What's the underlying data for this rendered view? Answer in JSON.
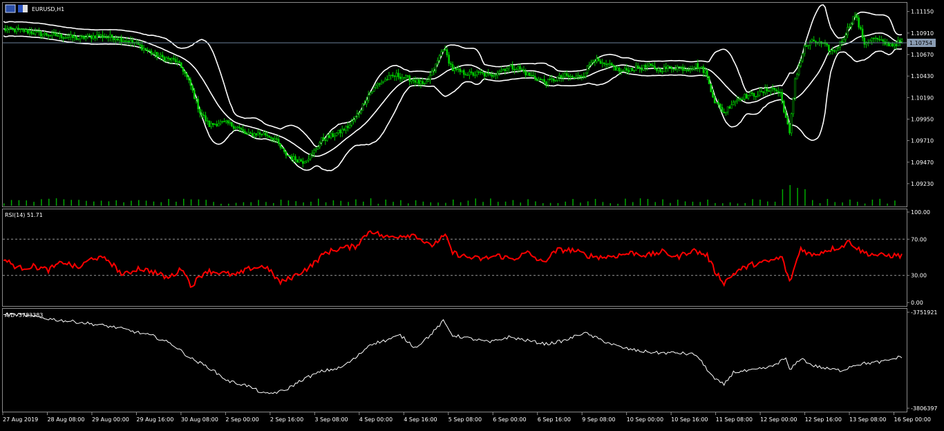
{
  "window": {
    "symbol_label": "EURUSD,H1"
  },
  "chart_data": [
    {
      "type": "candlestick",
      "title": "EURUSD,H1",
      "y_ticks": [
        "1.11150",
        "1.10910",
        "1.10670",
        "1.10430",
        "1.10190",
        "1.09950",
        "1.09710",
        "1.09470",
        "1.09230"
      ],
      "ylim": [
        1.0916,
        1.1124
      ],
      "current_price": "1.10754",
      "colors": {
        "candles": "#00cc00",
        "bands": "#ffffff",
        "price_line": "#6a7f99",
        "volume": "#00aa00"
      },
      "indicators": [
        "Bollinger Bands",
        "Volumes"
      ],
      "close_path": [
        [
          0,
          1.1095
        ],
        [
          10,
          1.1094
        ],
        [
          20,
          1.109
        ],
        [
          30,
          1.1088
        ],
        [
          40,
          1.1085
        ],
        [
          50,
          1.1088
        ],
        [
          60,
          1.1086
        ],
        [
          70,
          1.108
        ],
        [
          78,
          1.107
        ],
        [
          84,
          1.1064
        ],
        [
          88,
          1.1062
        ],
        [
          92,
          1.106
        ],
        [
          96,
          1.105
        ],
        [
          100,
          1.1032
        ],
        [
          105,
          1.1003
        ],
        [
          110,
          1.0988
        ],
        [
          115,
          1.0991
        ],
        [
          120,
          1.099
        ],
        [
          125,
          1.0986
        ],
        [
          130,
          1.0977
        ],
        [
          135,
          1.0979
        ],
        [
          140,
          1.0978
        ],
        [
          145,
          1.0973
        ],
        [
          150,
          1.0957
        ],
        [
          155,
          1.0951
        ],
        [
          160,
          1.0948
        ],
        [
          165,
          1.0956
        ],
        [
          170,
          1.0972
        ],
        [
          175,
          1.0976
        ],
        [
          180,
          1.0981
        ],
        [
          185,
          1.0988
        ],
        [
          190,
          1.1003
        ],
        [
          195,
          1.1022
        ],
        [
          200,
          1.1034
        ],
        [
          205,
          1.104
        ],
        [
          210,
          1.1044
        ],
        [
          215,
          1.1041
        ],
        [
          220,
          1.1038
        ],
        [
          225,
          1.1032
        ],
        [
          230,
          1.105
        ],
        [
          235,
          1.1075
        ],
        [
          240,
          1.105
        ],
        [
          245,
          1.1047
        ],
        [
          250,
          1.1045
        ],
        [
          255,
          1.1046
        ],
        [
          260,
          1.1043
        ],
        [
          265,
          1.1049
        ],
        [
          270,
          1.1053
        ],
        [
          275,
          1.1052
        ],
        [
          280,
          1.1045
        ],
        [
          285,
          1.104
        ],
        [
          290,
          1.1036
        ],
        [
          295,
          1.104
        ],
        [
          300,
          1.1043
        ],
        [
          305,
          1.1041
        ],
        [
          310,
          1.1045
        ],
        [
          315,
          1.1063
        ],
        [
          320,
          1.1055
        ],
        [
          325,
          1.1054
        ],
        [
          330,
          1.1048
        ],
        [
          335,
          1.1051
        ],
        [
          340,
          1.1052
        ],
        [
          345,
          1.1054
        ],
        [
          350,
          1.105
        ],
        [
          355,
          1.1052
        ],
        [
          360,
          1.1053
        ],
        [
          365,
          1.1051
        ],
        [
          370,
          1.1055
        ],
        [
          375,
          1.1048
        ],
        [
          380,
          1.1015
        ],
        [
          385,
          1.1002
        ],
        [
          390,
          1.1015
        ],
        [
          395,
          1.102
        ],
        [
          400,
          1.1022
        ],
        [
          405,
          1.1024
        ],
        [
          410,
          1.103
        ],
        [
          415,
          1.1024
        ],
        [
          420,
          1.0978
        ],
        [
          423,
          1.104
        ],
        [
          428,
          1.1075
        ],
        [
          433,
          1.1082
        ],
        [
          438,
          1.1078
        ],
        [
          443,
          1.107
        ],
        [
          448,
          1.1082
        ],
        [
          452,
          1.11
        ],
        [
          455,
          1.1112
        ],
        [
          460,
          1.108
        ],
        [
          465,
          1.1085
        ],
        [
          470,
          1.108
        ],
        [
          475,
          1.1078
        ],
        [
          480,
          1.1082
        ]
      ]
    },
    {
      "type": "line",
      "title": "RSI(14) 51.71",
      "series": [
        {
          "name": "RSI(14)",
          "color": "#ff0000"
        }
      ],
      "y_ticks": [
        "100.00",
        "70.00",
        "30.00",
        "0.00"
      ],
      "levels": [
        70,
        30
      ],
      "ylim": [
        0,
        100
      ],
      "values_path": [
        [
          0,
          48
        ],
        [
          8,
          38
        ],
        [
          16,
          40
        ],
        [
          24,
          36
        ],
        [
          32,
          45
        ],
        [
          40,
          38
        ],
        [
          48,
          50
        ],
        [
          56,
          47
        ],
        [
          64,
          30
        ],
        [
          72,
          38
        ],
        [
          80,
          34
        ],
        [
          88,
          27
        ],
        [
          96,
          38
        ],
        [
          100,
          18
        ],
        [
          108,
          35
        ],
        [
          116,
          33
        ],
        [
          124,
          30
        ],
        [
          132,
          38
        ],
        [
          140,
          40
        ],
        [
          148,
          22
        ],
        [
          156,
          30
        ],
        [
          164,
          40
        ],
        [
          172,
          55
        ],
        [
          180,
          60
        ],
        [
          188,
          62
        ],
        [
          196,
          80
        ],
        [
          204,
          72
        ],
        [
          212,
          74
        ],
        [
          220,
          75
        ],
        [
          228,
          62
        ],
        [
          236,
          74
        ],
        [
          240,
          55
        ],
        [
          248,
          50
        ],
        [
          256,
          48
        ],
        [
          264,
          52
        ],
        [
          272,
          48
        ],
        [
          280,
          55
        ],
        [
          288,
          44
        ],
        [
          296,
          58
        ],
        [
          304,
          58
        ],
        [
          312,
          52
        ],
        [
          320,
          50
        ],
        [
          328,
          52
        ],
        [
          336,
          55
        ],
        [
          344,
          52
        ],
        [
          352,
          56
        ],
        [
          360,
          50
        ],
        [
          368,
          58
        ],
        [
          376,
          52
        ],
        [
          380,
          35
        ],
        [
          385,
          22
        ],
        [
          392,
          35
        ],
        [
          400,
          42
        ],
        [
          408,
          45
        ],
        [
          416,
          50
        ],
        [
          420,
          22
        ],
        [
          426,
          60
        ],
        [
          432,
          52
        ],
        [
          440,
          58
        ],
        [
          448,
          62
        ],
        [
          452,
          68
        ],
        [
          456,
          60
        ],
        [
          460,
          55
        ],
        [
          468,
          52
        ],
        [
          476,
          52
        ],
        [
          480,
          51.71
        ]
      ]
    },
    {
      "type": "line",
      "title": "A/D -3783383",
      "series": [
        {
          "name": "A/D",
          "color": "#ffffff"
        }
      ],
      "y_ticks": [
        "-3751921",
        "-3806397"
      ],
      "ylim": [
        -3806397,
        -3751921
      ],
      "values_path": [
        [
          0,
          -3753000
        ],
        [
          10,
          -3753500
        ],
        [
          20,
          -3755000
        ],
        [
          30,
          -3756500
        ],
        [
          40,
          -3757500
        ],
        [
          50,
          -3759000
        ],
        [
          60,
          -3760500
        ],
        [
          70,
          -3763000
        ],
        [
          80,
          -3765500
        ],
        [
          90,
          -3770000
        ],
        [
          100,
          -3778000
        ],
        [
          110,
          -3783500
        ],
        [
          120,
          -3791000
        ],
        [
          130,
          -3793500
        ],
        [
          140,
          -3798500
        ],
        [
          150,
          -3796500
        ],
        [
          160,
          -3790000
        ],
        [
          170,
          -3785500
        ],
        [
          180,
          -3783500
        ],
        [
          188,
          -3778000
        ],
        [
          196,
          -3770000
        ],
        [
          204,
          -3768000
        ],
        [
          212,
          -3765000
        ],
        [
          220,
          -3772000
        ],
        [
          228,
          -3765000
        ],
        [
          235,
          -3757000
        ],
        [
          240,
          -3765000
        ],
        [
          250,
          -3767000
        ],
        [
          260,
          -3769000
        ],
        [
          270,
          -3766000
        ],
        [
          280,
          -3768000
        ],
        [
          290,
          -3770000
        ],
        [
          300,
          -3768000
        ],
        [
          310,
          -3763500
        ],
        [
          320,
          -3768000
        ],
        [
          330,
          -3772000
        ],
        [
          340,
          -3774000
        ],
        [
          350,
          -3775000
        ],
        [
          360,
          -3775000
        ],
        [
          370,
          -3776000
        ],
        [
          380,
          -3790000
        ],
        [
          385,
          -3793000
        ],
        [
          390,
          -3786000
        ],
        [
          400,
          -3785000
        ],
        [
          410,
          -3783000
        ],
        [
          418,
          -3778000
        ],
        [
          420,
          -3785000
        ],
        [
          426,
          -3778000
        ],
        [
          432,
          -3782000
        ],
        [
          440,
          -3784000
        ],
        [
          448,
          -3785000
        ],
        [
          454,
          -3782000
        ],
        [
          460,
          -3781000
        ],
        [
          470,
          -3780000
        ],
        [
          480,
          -3777000
        ]
      ]
    }
  ],
  "time_axis": {
    "labels": [
      "27 Aug 2019",
      "28 Aug 08:00",
      "29 Aug 00:00",
      "29 Aug 16:00",
      "30 Aug 08:00",
      "2 Sep 00:00",
      "2 Sep 16:00",
      "3 Sep 08:00",
      "4 Sep 00:00",
      "4 Sep 16:00",
      "5 Sep 08:00",
      "6 Sep 00:00",
      "6 Sep 16:00",
      "9 Sep 08:00",
      "10 Sep 00:00",
      "10 Sep 16:00",
      "11 Sep 08:00",
      "12 Sep 00:00",
      "12 Sep 16:00",
      "13 Sep 08:00",
      "16 Sep 00:00"
    ]
  }
}
